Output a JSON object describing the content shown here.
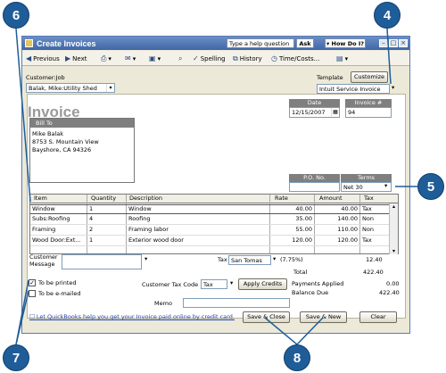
{
  "callouts": [
    "6",
    "4",
    "5",
    "7",
    "8"
  ],
  "window": {
    "title": "Create Invoices",
    "help_placeholder": "Type a help question",
    "ask_label": "Ask",
    "howdo_label": "How Do I?"
  },
  "toolbar": {
    "previous": "Previous",
    "next": "Next",
    "spelling": "Spelling",
    "history": "History",
    "timecosts": "Time/Costs..."
  },
  "form": {
    "customer_job_label": "Customer:Job",
    "customer_job_value": "Balak, Mike:Utility Shed",
    "template_label": "Template",
    "customize_label": "Customize",
    "template_value": "Intuit Service Invoice",
    "invoice_title": "Invoice",
    "date_label": "Date",
    "date_value": "12/15/2007",
    "invoice_no_label": "Invoice #",
    "invoice_no_value": "94",
    "bill_to_label": "Bill To",
    "bill_to_lines": [
      "Mike Balak",
      "8753 S. Mountain View",
      "Bayshore, CA  94326"
    ],
    "po_label": "P.O. No.",
    "po_value": "",
    "terms_label": "Terms",
    "terms_value": "Net 30"
  },
  "items_table": {
    "headers": [
      "Item",
      "Quantity",
      "Description",
      "Rate",
      "Amount",
      "Tax"
    ],
    "rows": [
      [
        "Window",
        "1",
        "Window",
        "40.00",
        "40.00",
        "Tax"
      ],
      [
        "Subs:Roofing",
        "4",
        "Roofing",
        "35.00",
        "140.00",
        "Non"
      ],
      [
        "Framing",
        "2",
        "Framing labor",
        "55.00",
        "110.00",
        "Non"
      ],
      [
        "Wood Door:Ext...",
        "1",
        "Exterior wood door",
        "120.00",
        "120.00",
        "Tax"
      ]
    ]
  },
  "footer": {
    "customer_message_label": "Customer Message",
    "tax_label": "Tax",
    "tax_item": "San Tomas",
    "tax_rate": "(7.75%)",
    "tax_amount": "12.40",
    "total_label": "Total",
    "total_value": "422.40",
    "to_be_printed": "To be printed",
    "to_be_emailed": "To be e-mailed",
    "customer_tax_code_label": "Customer Tax Code",
    "customer_tax_code_value": "Tax",
    "apply_credits": "Apply Credits",
    "payments_applied_label": "Payments Applied",
    "payments_applied_value": "0.00",
    "balance_due_label": "Balance Due",
    "balance_due_value": "422.40",
    "memo_label": "Memo",
    "online_link": "Let QuickBooks help you get your Invoice paid online by credit card.",
    "save_close": "Save & Close",
    "save_new": "Save & New",
    "clear": "Clear"
  }
}
